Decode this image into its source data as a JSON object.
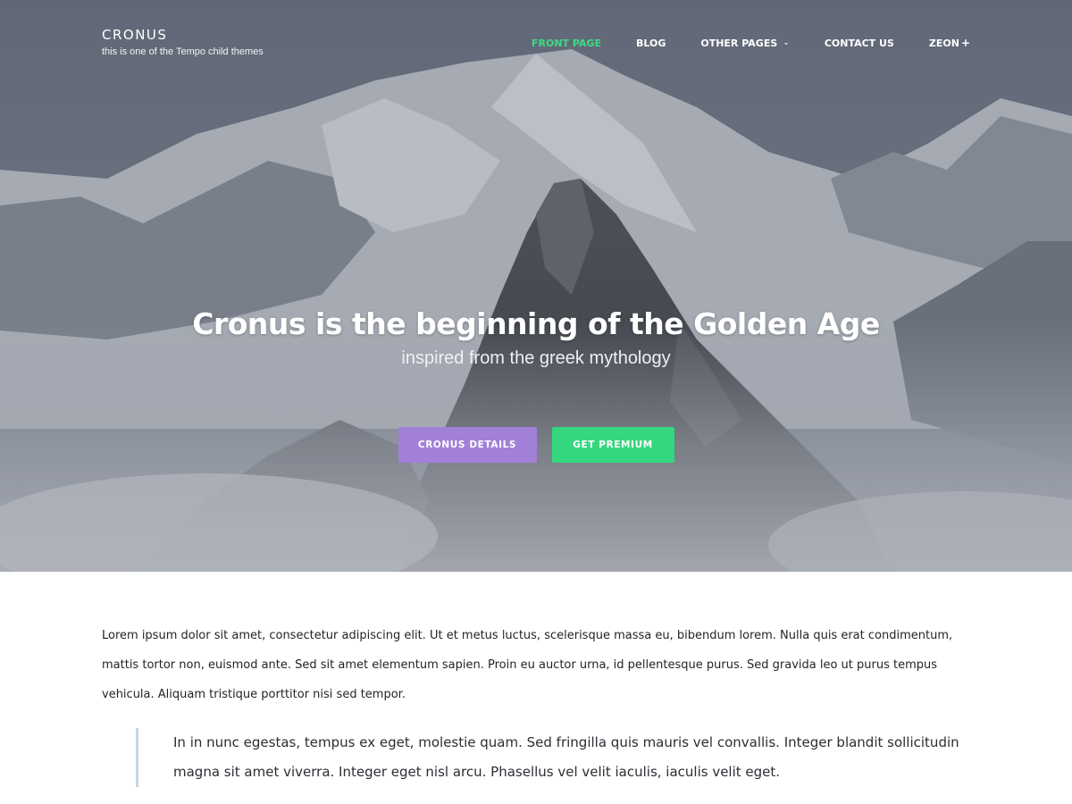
{
  "site": {
    "title": "CRONUS",
    "tagline": "this is one of the Tempo child themes"
  },
  "nav": {
    "items": [
      {
        "label": "FRONT PAGE",
        "active": true
      },
      {
        "label": "BLOG"
      },
      {
        "label": "OTHER PAGES",
        "icon": "chevron-down-icon",
        "icon_glyph": "⌄"
      },
      {
        "label": "CONTACT US"
      },
      {
        "label": "ZEON",
        "icon": "plus-icon",
        "icon_glyph": "+"
      }
    ]
  },
  "hero": {
    "title": "Cronus is the beginning of the Golden Age",
    "subtitle": "inspired from the greek mythology",
    "primary_button": "CRONUS DETAILS",
    "secondary_button": "GET PREMIUM"
  },
  "content": {
    "paragraph": "Lorem ipsum dolor sit amet, consectetur adipiscing elit. Ut et metus luctus, scelerisque massa eu, bibendum lorem. Nulla quis erat condimentum, mattis tortor non, euismod ante. Sed sit amet elementum sapien. Proin eu auctor urna, id pellentesque purus. Sed gravida leo ut purus tempus vehicula. Aliquam tristique porttitor nisi sed tempor.",
    "blockquote": "In in nunc egestas, tempus ex eget, molestie quam. Sed fringilla quis mauris vel convallis. Integer blandit sollicitudin magna sit amet viverra. Integer eget nisl arcu. Phasellus vel velit iaculis, iaculis velit eget."
  },
  "colors": {
    "nav_active": "#3ddc84",
    "primary_button": "#a27fd8",
    "secondary_button": "#34d77e",
    "blockquote_border": "#c8d6e2"
  }
}
